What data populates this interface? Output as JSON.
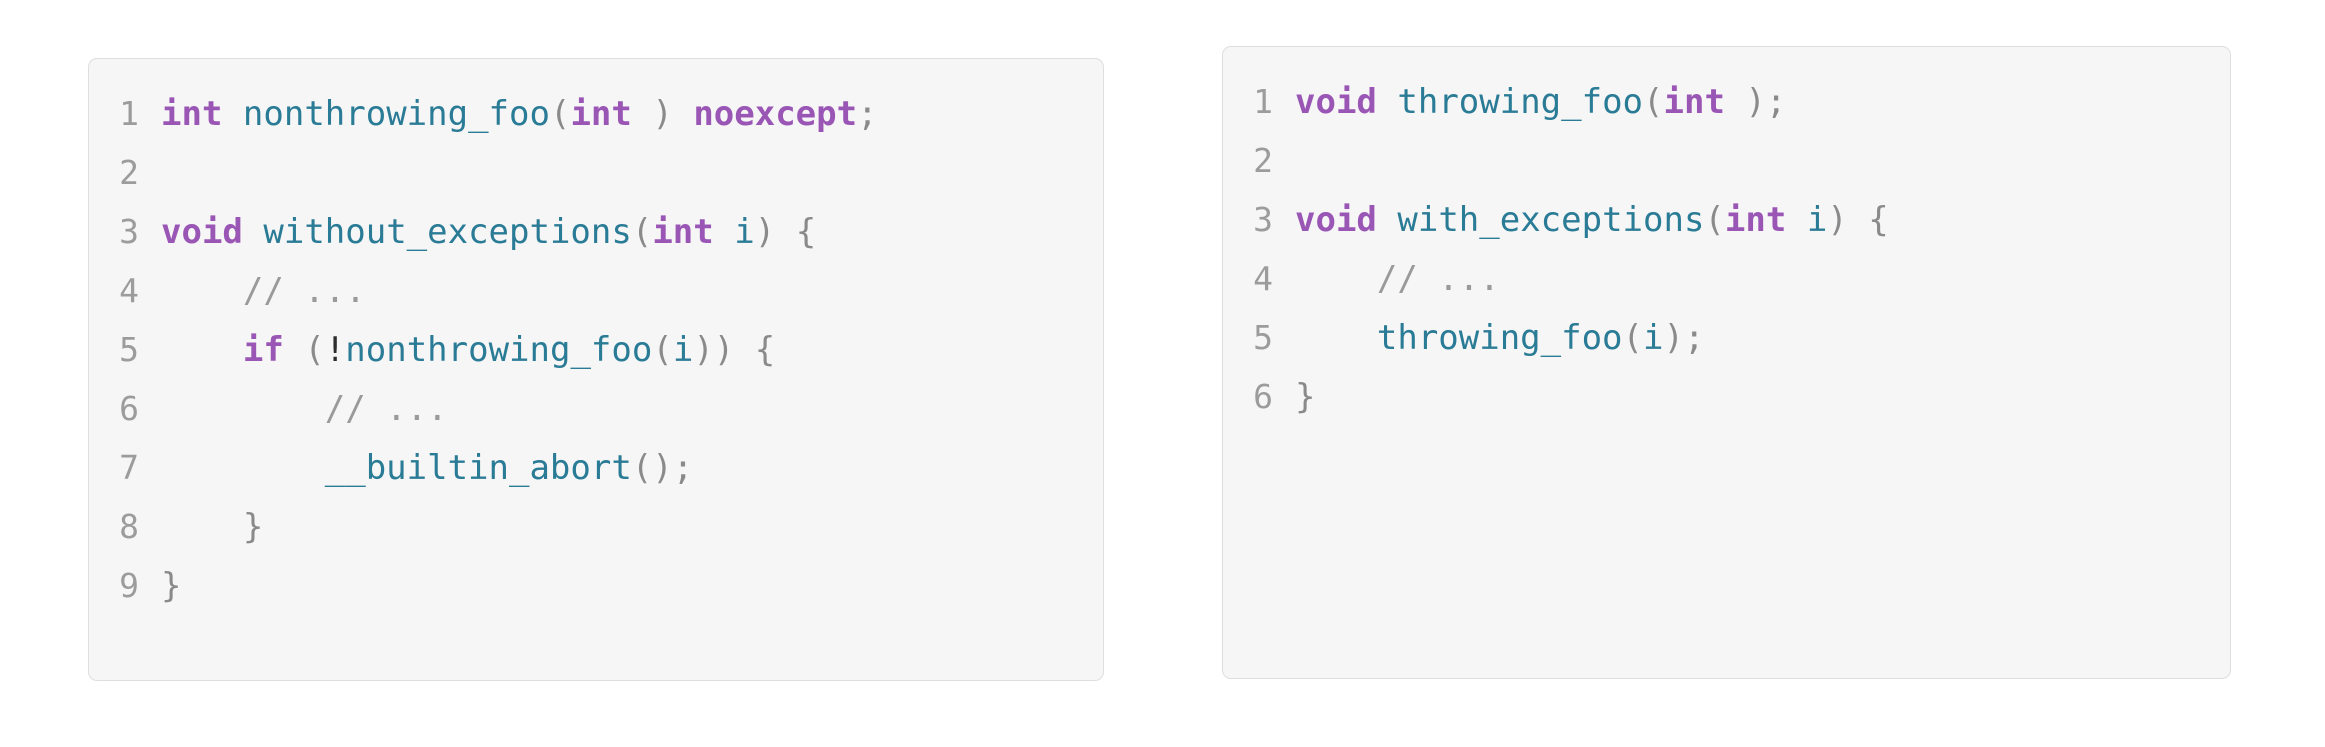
{
  "theme": {
    "page_background": "#ffffff",
    "panel_background": "#f6f6f6",
    "panel_border": "#dedede",
    "line_number_color": "#9c9c9c",
    "keyword_color": "#9a56b5",
    "identifier_color": "#2a7b96",
    "punctuation_color": "#8a8a8a",
    "comment_color": "#9a9a9a",
    "operator_color": "#2d2d2d"
  },
  "panels": [
    {
      "id": "left",
      "name": "nonthrowing-code-panel",
      "language": "cpp",
      "line_count": 9,
      "line_numbers": [
        "1",
        "2",
        "3",
        "4",
        "5",
        "6",
        "7",
        "8",
        "9"
      ],
      "plain_text": "int nonthrowing_foo(int ) noexcept;\n\nvoid without_exceptions(int i) {\n    // ...\n    if (!nonthrowing_foo(i)) {\n        // ...\n        __builtin_abort();\n    }\n}",
      "lines": [
        {
          "n": "1",
          "tokens": [
            {
              "t": "int",
              "c": "kw"
            },
            {
              "t": " ",
              "c": "pl"
            },
            {
              "t": "nonthrowing_foo",
              "c": "fn"
            },
            {
              "t": "(",
              "c": "punc"
            },
            {
              "t": "int",
              "c": "kw"
            },
            {
              "t": " ",
              "c": "pl"
            },
            {
              "t": ")",
              "c": "punc"
            },
            {
              "t": " ",
              "c": "pl"
            },
            {
              "t": "noexcept",
              "c": "kw"
            },
            {
              "t": ";",
              "c": "punc"
            }
          ]
        },
        {
          "n": "2",
          "tokens": []
        },
        {
          "n": "3",
          "tokens": [
            {
              "t": "void",
              "c": "kw"
            },
            {
              "t": " ",
              "c": "pl"
            },
            {
              "t": "without_exceptions",
              "c": "fn"
            },
            {
              "t": "(",
              "c": "punc"
            },
            {
              "t": "int",
              "c": "kw"
            },
            {
              "t": " ",
              "c": "pl"
            },
            {
              "t": "i",
              "c": "var"
            },
            {
              "t": ")",
              "c": "punc"
            },
            {
              "t": " ",
              "c": "pl"
            },
            {
              "t": "{",
              "c": "punc"
            }
          ]
        },
        {
          "n": "4",
          "tokens": [
            {
              "t": "    ",
              "c": "pl"
            },
            {
              "t": "// ...",
              "c": "cmt"
            }
          ]
        },
        {
          "n": "5",
          "tokens": [
            {
              "t": "    ",
              "c": "pl"
            },
            {
              "t": "if",
              "c": "kw"
            },
            {
              "t": " ",
              "c": "pl"
            },
            {
              "t": "(",
              "c": "punc"
            },
            {
              "t": "!",
              "c": "op"
            },
            {
              "t": "nonthrowing_foo",
              "c": "fn"
            },
            {
              "t": "(",
              "c": "punc"
            },
            {
              "t": "i",
              "c": "var"
            },
            {
              "t": "))",
              "c": "punc"
            },
            {
              "t": " ",
              "c": "pl"
            },
            {
              "t": "{",
              "c": "punc"
            }
          ]
        },
        {
          "n": "6",
          "tokens": [
            {
              "t": "        ",
              "c": "pl"
            },
            {
              "t": "// ...",
              "c": "cmt"
            }
          ]
        },
        {
          "n": "7",
          "tokens": [
            {
              "t": "        ",
              "c": "pl"
            },
            {
              "t": "__builtin_abort",
              "c": "fn"
            },
            {
              "t": "();",
              "c": "punc"
            }
          ]
        },
        {
          "n": "8",
          "tokens": [
            {
              "t": "    ",
              "c": "pl"
            },
            {
              "t": "}",
              "c": "punc"
            }
          ]
        },
        {
          "n": "9",
          "tokens": [
            {
              "t": "}",
              "c": "punc"
            }
          ]
        }
      ]
    },
    {
      "id": "right",
      "name": "throwing-code-panel",
      "language": "cpp",
      "line_count": 6,
      "line_numbers": [
        "1",
        "2",
        "3",
        "4",
        "5",
        "6"
      ],
      "plain_text": "void throwing_foo(int );\n\nvoid with_exceptions(int i) {\n    // ...\n    throwing_foo(i);\n}",
      "lines": [
        {
          "n": "1",
          "tokens": [
            {
              "t": "void",
              "c": "kw"
            },
            {
              "t": " ",
              "c": "pl"
            },
            {
              "t": "throwing_foo",
              "c": "fn"
            },
            {
              "t": "(",
              "c": "punc"
            },
            {
              "t": "int",
              "c": "kw"
            },
            {
              "t": " ",
              "c": "pl"
            },
            {
              "t": ");",
              "c": "punc"
            }
          ]
        },
        {
          "n": "2",
          "tokens": []
        },
        {
          "n": "3",
          "tokens": [
            {
              "t": "void",
              "c": "kw"
            },
            {
              "t": " ",
              "c": "pl"
            },
            {
              "t": "with_exceptions",
              "c": "fn"
            },
            {
              "t": "(",
              "c": "punc"
            },
            {
              "t": "int",
              "c": "kw"
            },
            {
              "t": " ",
              "c": "pl"
            },
            {
              "t": "i",
              "c": "var"
            },
            {
              "t": ")",
              "c": "punc"
            },
            {
              "t": " ",
              "c": "pl"
            },
            {
              "t": "{",
              "c": "punc"
            }
          ]
        },
        {
          "n": "4",
          "tokens": [
            {
              "t": "    ",
              "c": "pl"
            },
            {
              "t": "// ...",
              "c": "cmt"
            }
          ]
        },
        {
          "n": "5",
          "tokens": [
            {
              "t": "    ",
              "c": "pl"
            },
            {
              "t": "throwing_foo",
              "c": "fn"
            },
            {
              "t": "(",
              "c": "punc"
            },
            {
              "t": "i",
              "c": "var"
            },
            {
              "t": ");",
              "c": "punc"
            }
          ]
        },
        {
          "n": "6",
          "tokens": [
            {
              "t": "}",
              "c": "punc"
            }
          ]
        }
      ]
    }
  ]
}
